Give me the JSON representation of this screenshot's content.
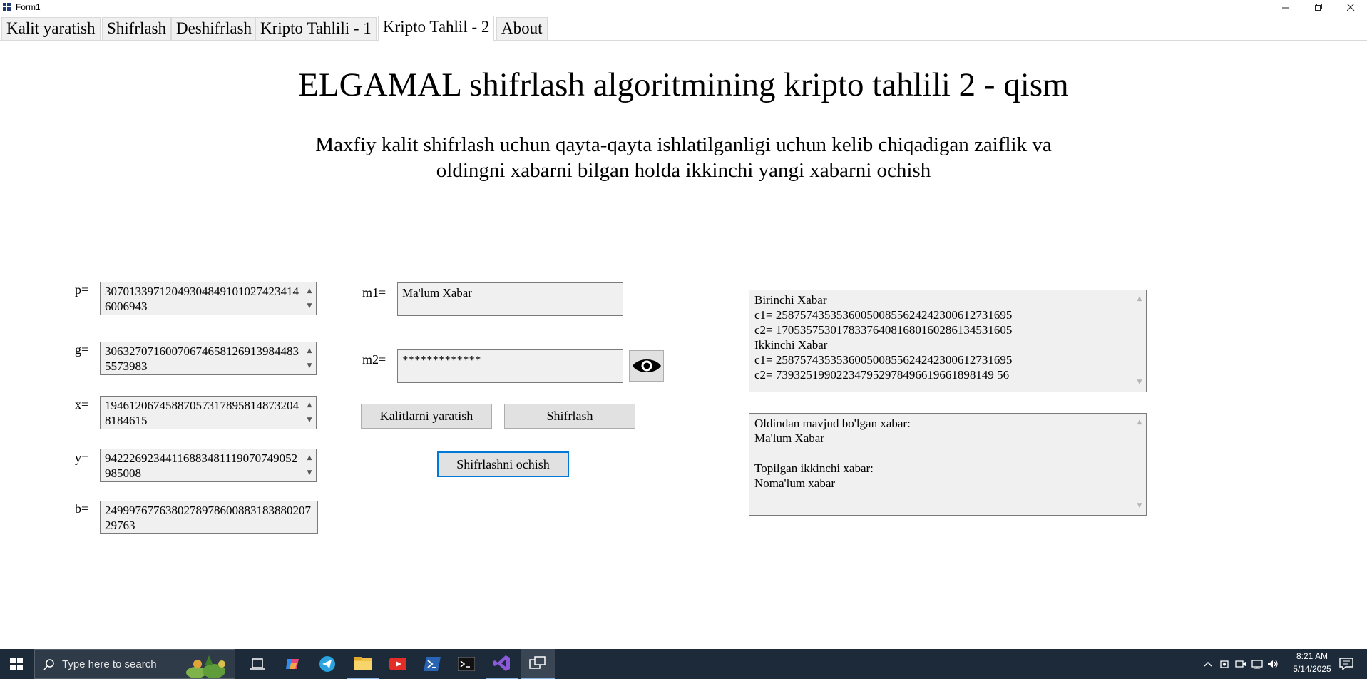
{
  "window": {
    "title": "Form1"
  },
  "tabs": [
    {
      "label": "Kalit yaratish"
    },
    {
      "label": "Shifrlash"
    },
    {
      "label": "Deshifrlash"
    },
    {
      "label": "Kripto Tahlili - 1"
    },
    {
      "label": "Kripto Tahlil - 2"
    },
    {
      "label": "About"
    }
  ],
  "active_tab": "Kripto Tahlil - 2",
  "page": {
    "title": "ELGAMAL shifrlash algoritmining kripto tahlili 2 - qism",
    "subtitle_line1": "Maxfiy kalit shifrlash uchun qayta-qayta ishlatilganligi uchun kelib chiqadigan zaiflik va",
    "subtitle_line2": "oldingni xabarni bilgan holda ikkinchi yangi xabarni ochish"
  },
  "keys": {
    "p_label": "p=",
    "p_value": "30701339712049304849101027423414600694​3",
    "g_label": "g=",
    "g_value": "306327071600706746581269139844835573983",
    "x_label": "x=",
    "x_value": "194612067458870573178958148732048184615",
    "y_label": "y=",
    "y_value": "9422269234411688348111907074905​2985008",
    "b_label": "b=",
    "b_value": "249997677638027897860088318388020729763"
  },
  "messages": {
    "m1_label": "m1=",
    "m1_value": "Ma'lum Xabar",
    "m2_label": "m2=",
    "m2_value": "*************"
  },
  "buttons": {
    "generate_keys": "Kalitlarni yaratish",
    "encrypt": "Shifrlash",
    "break": "Shifrlashni ochish"
  },
  "cipher_output": {
    "lines": [
      "Birinchi Xabar",
      "c1= 258757435353600500855624242300612731695",
      "c2= 170535753017833764081680160286134531605",
      "Ikkinchi Xabar",
      "c1= 258757435353600500855624242300612731695",
      "c2= 739325199022347952978496619661898149 56"
    ]
  },
  "result_output": {
    "lines": [
      "Oldindan mavjud bo'lgan xabar:",
      "Ma'lum Xabar",
      "",
      "Topilgan ikkinchi xabar:",
      "Noma'lum xabar"
    ]
  },
  "taskbar": {
    "search_placeholder": "Type here to search",
    "time": "8:21 AM",
    "date": "5/14/2025"
  }
}
